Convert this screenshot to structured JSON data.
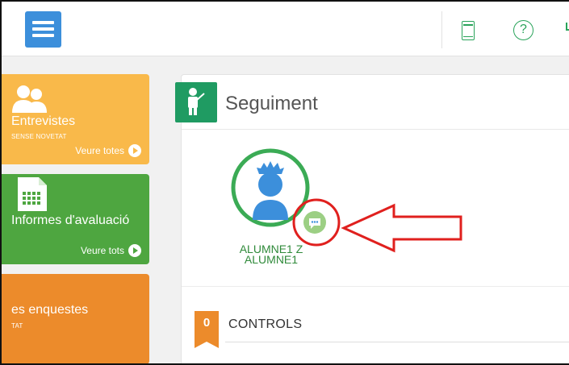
{
  "topbar": {
    "menu_icon": "hamburger-icon",
    "tablet_icon": "tablet-icon",
    "help_glyph": "?",
    "help_icon": "help-icon"
  },
  "tiles": {
    "interviews": {
      "title": "Entrevistes",
      "subtitle": "SENSE NOVETAT",
      "link": "Veure totes",
      "color": "#f9b94a",
      "icon": "people-icon"
    },
    "reports": {
      "title": "Informes d'avaluació",
      "link": "Veure tots",
      "color": "#4ea640",
      "icon": "document-icon"
    },
    "surveys": {
      "title": "es enquestes",
      "subtitle": "TAT",
      "color": "#ec8b2b"
    }
  },
  "panel": {
    "title": "Seguiment",
    "header_icon": "teacher-board-icon",
    "header_color": "#1f9b62",
    "student": {
      "name_line1": "ALUMNE1 Z",
      "name_line2": "ALUMNE1",
      "avatar_icon": "student-avatar-icon",
      "chat_icon": "chat-bubble-icon",
      "ring_color": "#3bab55"
    },
    "controls": {
      "count": "0",
      "label": "CONTROLS",
      "badge_color": "#ec8b2b"
    }
  },
  "annotation": {
    "circle_color": "#e0201e",
    "arrow_color": "#e0201e"
  }
}
